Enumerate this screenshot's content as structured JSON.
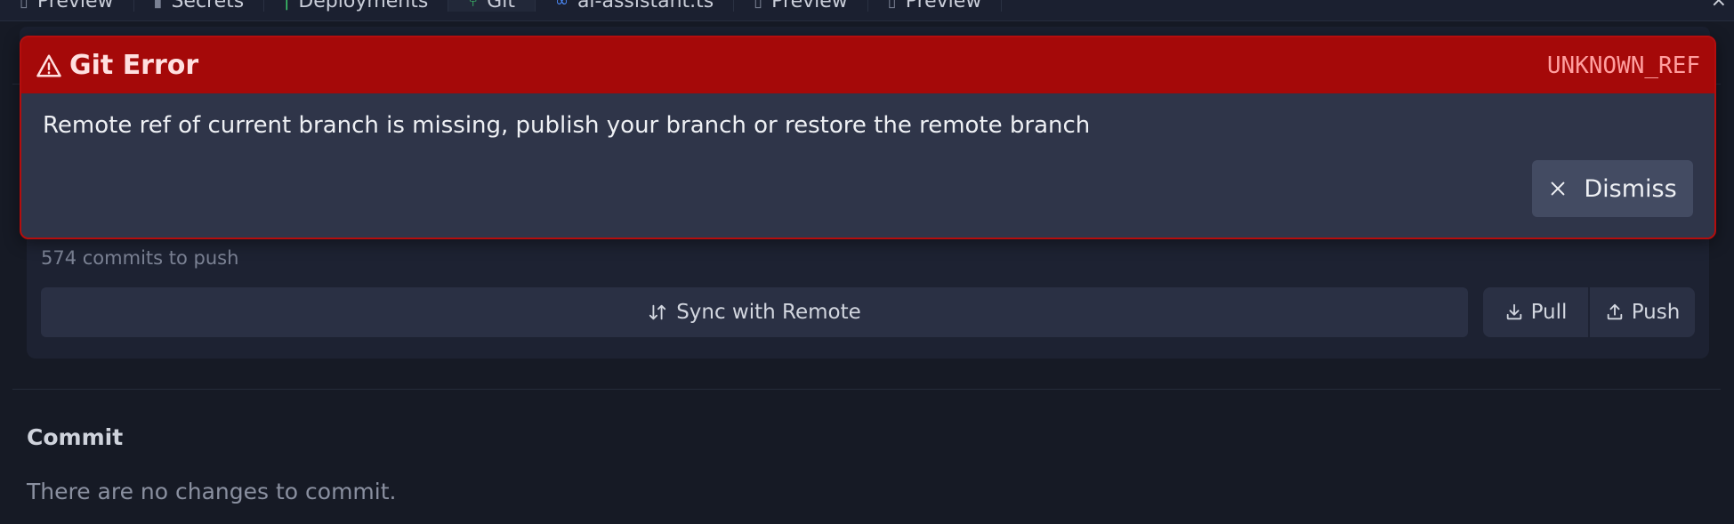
{
  "tabs": [
    {
      "label": "Preview",
      "icon": "file-icon"
    },
    {
      "label": "Secrets",
      "icon": "lock-icon"
    },
    {
      "label": "Deployments",
      "icon": "deploy-icon"
    },
    {
      "label": "Git",
      "icon": "git-icon"
    },
    {
      "label": "ai-assistant.ts",
      "icon": "code-icon"
    },
    {
      "label": "Preview",
      "icon": "file-icon"
    },
    {
      "label": "Preview",
      "icon": "file-icon"
    }
  ],
  "error": {
    "title": "Git Error",
    "code": "UNKNOWN_REF",
    "message": "Remote ref of current branch is missing, publish your branch or restore the remote branch",
    "dismiss_label": "Dismiss",
    "colors": {
      "header": "#a50909",
      "border": "#b50d0d",
      "code": "#ff9e9e"
    }
  },
  "sync": {
    "commits_to_push": "574 commits to push",
    "sync_label": "Sync with Remote",
    "pull_label": "Pull",
    "push_label": "Push"
  },
  "commit": {
    "heading": "Commit",
    "empty_text": "There are no changes to commit."
  }
}
